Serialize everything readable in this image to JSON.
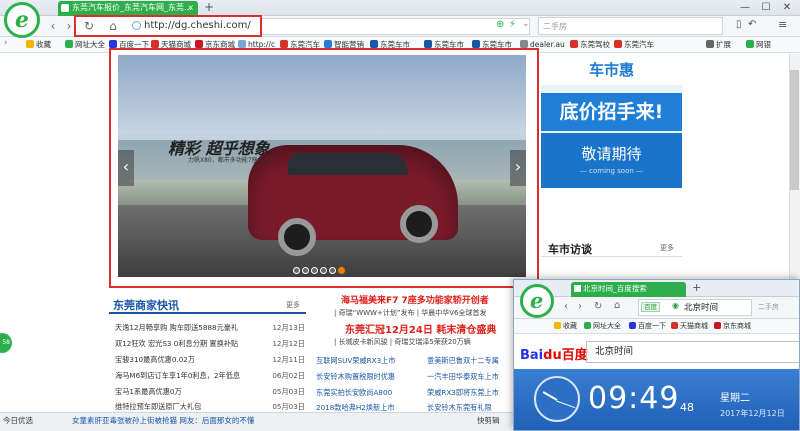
{
  "browser": {
    "tab_title": "东莞汽车报价_东莞汽车网_东莞...",
    "new_tab": "+",
    "url": "http://dg.cheshi.com/",
    "search_placeholder": "二手房",
    "window_controls": [
      "—",
      "☐",
      "✕"
    ]
  },
  "bookmarks": [
    {
      "label": "收藏",
      "color": "#f2b600"
    },
    {
      "label": "网址大全",
      "color": "#2cb04c"
    },
    {
      "label": "百度一下",
      "color": "#2932e1"
    },
    {
      "label": "天猫商城",
      "color": "#d9302c"
    },
    {
      "label": "京东商城",
      "color": "#c81623"
    },
    {
      "label": "http://c",
      "color": "#7aa7d6"
    },
    {
      "label": "东莞汽车",
      "color": "#d9302c"
    },
    {
      "label": "智能营销",
      "color": "#2b7ad6"
    },
    {
      "label": "东莞车市",
      "color": "#1a56a6"
    },
    {
      "label": "东莞车市",
      "color": "#1a56a6"
    },
    {
      "label": "东莞车市",
      "color": "#1a56a6"
    },
    {
      "label": "dealer.au",
      "color": "#888888"
    },
    {
      "label": "东莞驾校",
      "color": "#d9302c"
    },
    {
      "label": "东莞汽车",
      "color": "#d9302c"
    },
    {
      "label": "扩展",
      "color": "#666666"
    },
    {
      "label": "网银",
      "color": "#2cb04c"
    }
  ],
  "carousel": {
    "slogan": "精彩 超乎想象",
    "slogan_sub": "力帆X80，都市多功能7座SUV",
    "dots": 6,
    "active_dot": 5
  },
  "ad": {
    "line1": "车市惠",
    "line2": "底价招手来!",
    "line3": "敬请期待",
    "line4": "— coming soon —"
  },
  "visit": {
    "title": "车市访谈",
    "more": "更多"
  },
  "news": {
    "title": "东莞商家快讯",
    "more": "更多",
    "items": [
      {
        "text": "天逸12月畅享购 购车即送5888元豪礼",
        "date": "12月13日"
      },
      {
        "text": "双12狂欢 宏光S3 0利息分期 置换补贴",
        "date": "12月12日"
      },
      {
        "text": "宝骏310最高优惠0.02万",
        "date": "12月11日"
      },
      {
        "text": "海马M6到店订车享1年0利息，2年低息",
        "date": "06月02日"
      },
      {
        "text": "宝马1系最高优惠0万",
        "date": "05月03日"
      },
      {
        "text": "维特拉预车即送原厂大礼包",
        "date": "05月03日"
      }
    ]
  },
  "middle": {
    "headline1": "海马福美来F7 7座多功能家轿开创者",
    "sub1": "| 奇瑞“WWW+计划”发布 | 华晨中华V6全球首发",
    "headline2": "东莞汇冠12月24日 耗末清仓盛典",
    "sub2": "| 长城皮卡新风骏 | 奇瑞艾瑞泽5荣获20万辆",
    "col1": [
      "互联网SUV荣威RX3上市",
      "长安铃木购置税限时优惠",
      "东莞实拍长安欧尚A800",
      "2018款哈弗H2焕新上市"
    ],
    "col2": [
      "意美斯巴鲁双十二专属",
      "一汽丰田华泰双车上市",
      "荣威RX3即将东莞上市",
      "长安铃木东莞有礼限"
    ]
  },
  "popup": {
    "tab_title": "北京时间_百度搜索",
    "new_tab": "+",
    "badge": "百度",
    "address": "北京时间",
    "search_placeholder": "二手房",
    "bookmarks": [
      "收藏",
      "网址大全",
      "百度一下",
      "天猫商城",
      "京东商城"
    ],
    "baidu_logo_a": "Bai",
    "baidu_logo_b": "du",
    "baidu_logo_c": "百度",
    "query": "北京时间",
    "time": "09:49",
    "seconds": "48",
    "weekday": "星期二",
    "date": "2017年12月12日"
  },
  "status": {
    "today": "今日优选",
    "ticker": "女童素肝亚毒张被孙上街被抢猫 网友：后面那女的不懂",
    "right": "快剪辑"
  },
  "side_badge": "58"
}
